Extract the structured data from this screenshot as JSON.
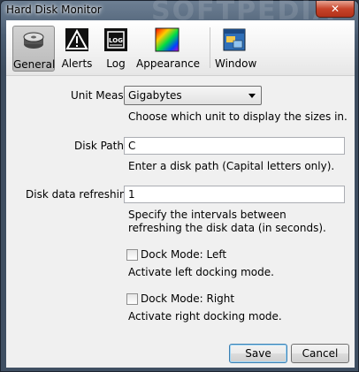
{
  "window": {
    "title": "Hard Disk Monitor",
    "close_label": "✕"
  },
  "toolbar": {
    "tabs": [
      {
        "label": "General",
        "icon": "disk-icon",
        "selected": true
      },
      {
        "label": "Alerts",
        "icon": "warning-icon"
      },
      {
        "label": "Log",
        "icon": "log-icon"
      },
      {
        "label": "Appearance",
        "icon": "palette-icon"
      },
      {
        "label": "Window",
        "icon": "window-icon"
      }
    ]
  },
  "general": {
    "unit_measure_label": "Unit Measure",
    "unit_measure_value": "Gigabytes",
    "unit_measure_hint": "Choose which unit to display the sizes in.",
    "disk_path_label": "Disk Path:",
    "disk_path_value": "C",
    "disk_path_hint": "Enter a disk path (Capital letters only).",
    "refresh_label": "Disk data refreshing:",
    "refresh_value": "1",
    "refresh_hint": "Specify the intervals between refreshing the disk data (in seconds).",
    "dock_left_label": "Dock Mode: Left",
    "dock_left_checked": false,
    "dock_left_hint": "Activate left docking mode.",
    "dock_right_label": "Dock Mode: Right",
    "dock_right_checked": false,
    "dock_right_hint": "Activate right docking mode."
  },
  "buttons": {
    "save": "Save",
    "cancel": "Cancel"
  },
  "watermark": "SOFTPEDIA"
}
